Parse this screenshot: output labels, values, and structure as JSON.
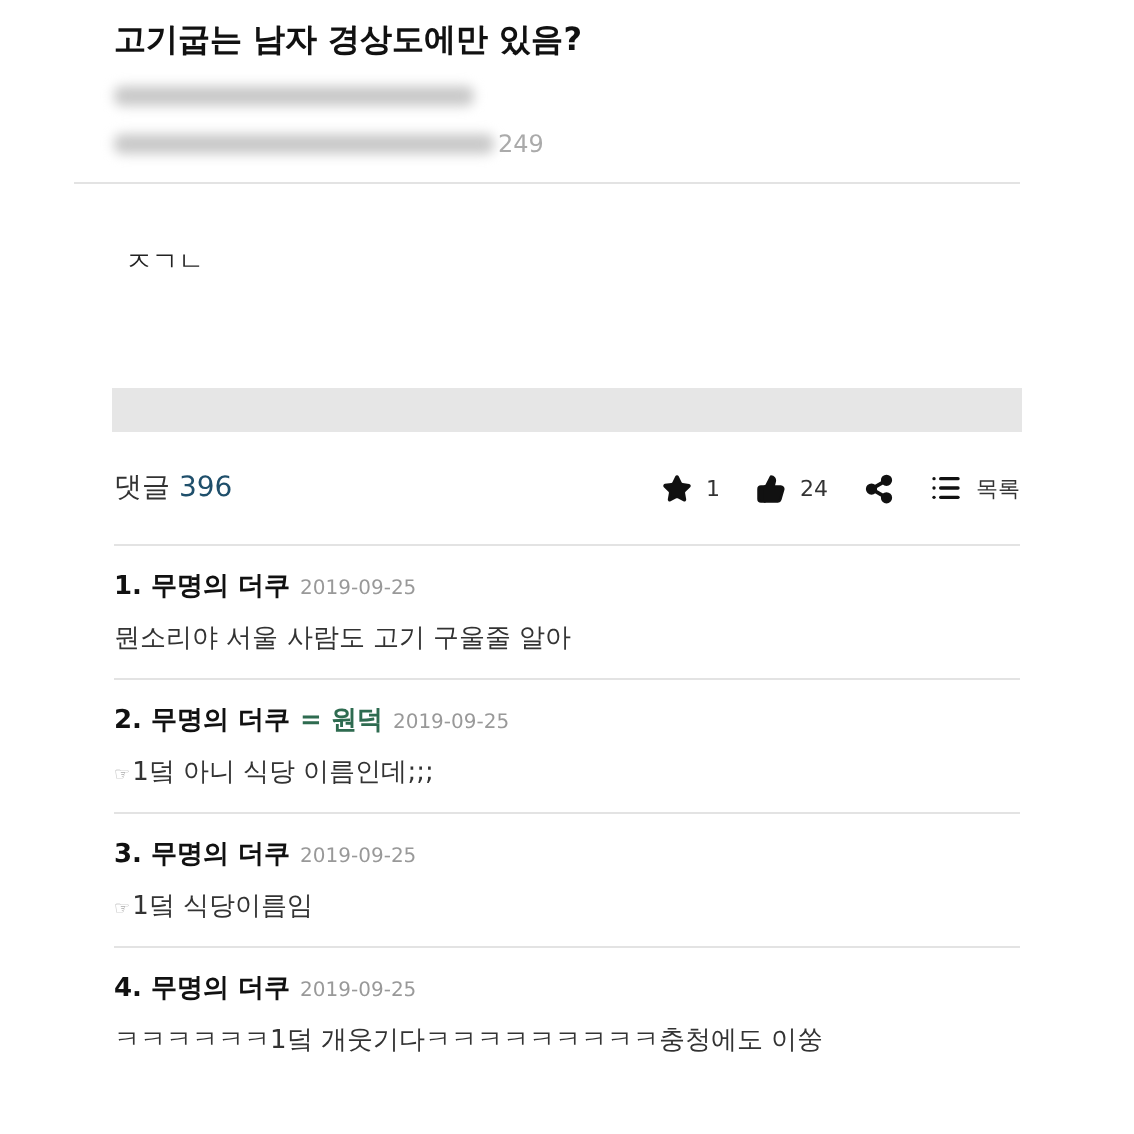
{
  "post": {
    "title": "고기굽는 남자 경상도에만 있음?",
    "meta_visible": "249",
    "body": "ㅈㄱㄴ"
  },
  "toolbar": {
    "comments_label": "댓글",
    "comments_count": "396",
    "favorites": "1",
    "likes": "24",
    "list_label": "목록"
  },
  "comments": [
    {
      "number": "1.",
      "author": "무명의 더쿠",
      "date": "2019-09-25",
      "text": "뭔소리야 서울 사람도 고기 구울줄 알아"
    },
    {
      "number": "2.",
      "author": "무명의 더쿠",
      "reply_to": "= 원덕",
      "date": "2019-09-25",
      "pointer": "☞",
      "text": "1덬 아니 식당 이름인데;;;"
    },
    {
      "number": "3.",
      "author": "무명의 더쿠",
      "date": "2019-09-25",
      "pointer": "☞",
      "text": "1덬 식당이름임"
    },
    {
      "number": "4.",
      "author": "무명의 더쿠",
      "date": "2019-09-25",
      "text": "ㅋㅋㅋㅋㅋㅋ1덬 개웃기다ㅋㅋㅋㅋㅋㅋㅋㅋㅋ충청에도 이쑹"
    }
  ]
}
